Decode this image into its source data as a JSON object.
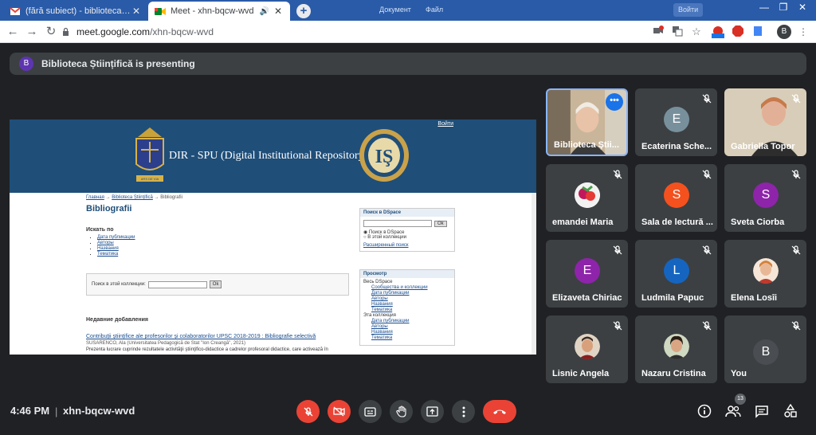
{
  "browser": {
    "tabs": [
      {
        "title": "(fără subiect) - biblioteca.catalog",
        "favicon": "gmail-icon",
        "active": false
      },
      {
        "title": "Meet - xhn-bqcw-wvd",
        "favicon": "meet-icon",
        "active": true
      }
    ],
    "address": {
      "host": "meet.google.com",
      "path": "/xhn-bqcw-wvd"
    },
    "ghost_buttons": [
      "Документ",
      "Файл",
      "Войти"
    ],
    "profile_initial": "B",
    "extension_new_label": "New",
    "extension_abp_label": "ABP"
  },
  "presenting": {
    "avatar_initial": "B",
    "text": "Biblioteca Științifică is presenting"
  },
  "shared_screen": {
    "login_link": "Войти",
    "repo_title": "DIR - SPU (Digital Institutional Repository)",
    "crest_motto": "ARS DE VIA",
    "seal_letters": "IŞ",
    "breadcrumb": [
      "Главная",
      "Biblioteca Ştiinţifică",
      "Bibliografii"
    ],
    "breadcrumb_sep": "→",
    "heading": "Bibliografii",
    "browse_heading": "Искать по",
    "browse_items": [
      "Дата публикации",
      "Авторы",
      "Названия",
      "Тематика"
    ],
    "search_label": "Поиск в этой коллекции:",
    "ok": "Ok",
    "recent_heading": "Недавние добавления",
    "recent_item_title": "Contribuţii ştiinţifice ale profesorilor şi colaboratorilor UPSC 2018-2019 : Bibliografie selectivă",
    "recent_item_meta": "SUSARENCO, Ala (Universitatea Pedagogică de Stat \"Ion Creangă\", 2021)",
    "recent_item_desc": "Prezenta lucrare cuprinde rezultatele activităţii ştiinţifico-didactice a cadrelor profesoral didactice, care activează în",
    "side_search_heading": "Поиск в DSpace",
    "side_radio_1": "Поиск в DSpace",
    "side_radio_2": "В этой коллекции",
    "side_advanced": "Расширенный поиск",
    "side_browse_heading": "Просмотр",
    "side_all_dspace": "Весь DSpace",
    "side_all_items": [
      "Сообщества и коллекции",
      "Дата публикации",
      "Авторы",
      "Названия",
      "Тематика"
    ],
    "side_this_collection": "Эта коллекция",
    "side_coll_items": [
      "Дата публикации",
      "Авторы",
      "Названия",
      "Тематика"
    ]
  },
  "participants": [
    {
      "name": "Biblioteca Ştii...",
      "initial": "",
      "color": "",
      "kind": "photo-speaking",
      "muted": false
    },
    {
      "name": "Ecaterina Sche...",
      "initial": "E",
      "color": "#78909c",
      "kind": "avatar",
      "muted": true
    },
    {
      "name": "Gabriella Topor",
      "initial": "",
      "color": "",
      "kind": "photo",
      "muted": true
    },
    {
      "name": "emandei Maria",
      "initial": "",
      "color": "#c2185b",
      "kind": "avatar-photo",
      "muted": true
    },
    {
      "name": "Sala de lectură ...",
      "initial": "S",
      "color": "#f4511e",
      "kind": "avatar",
      "muted": true
    },
    {
      "name": "Sveta Ciorba",
      "initial": "S",
      "color": "#8e24aa",
      "kind": "avatar",
      "muted": true
    },
    {
      "name": "Elizaveta Chiriac",
      "initial": "E",
      "color": "#8e24aa",
      "kind": "avatar",
      "muted": true
    },
    {
      "name": "Ludmila Papuc",
      "initial": "L",
      "color": "#1565c0",
      "kind": "avatar",
      "muted": true
    },
    {
      "name": "Elena Losîi",
      "initial": "",
      "color": "#e0a070",
      "kind": "avatar-photo",
      "muted": true
    },
    {
      "name": "Lisnic Angela",
      "initial": "",
      "color": "#c98b6b",
      "kind": "avatar-photo",
      "muted": true
    },
    {
      "name": "Nazaru Cristina",
      "initial": "",
      "color": "#b07b5c",
      "kind": "avatar-photo",
      "muted": true
    },
    {
      "name": "You",
      "initial": "B",
      "color": "#3c4043",
      "kind": "avatar",
      "muted": true
    }
  ],
  "bottom_bar": {
    "time": "4:46 PM",
    "separator": "|",
    "meeting_code": "xhn-bqcw-wvd",
    "participant_count": "13"
  },
  "colors": {
    "meet_bg": "#202124",
    "tile_bg": "#3c4043",
    "red": "#ea4335",
    "tab_strip": "#2a5ba8",
    "dspace_blue": "#1f4e79"
  }
}
